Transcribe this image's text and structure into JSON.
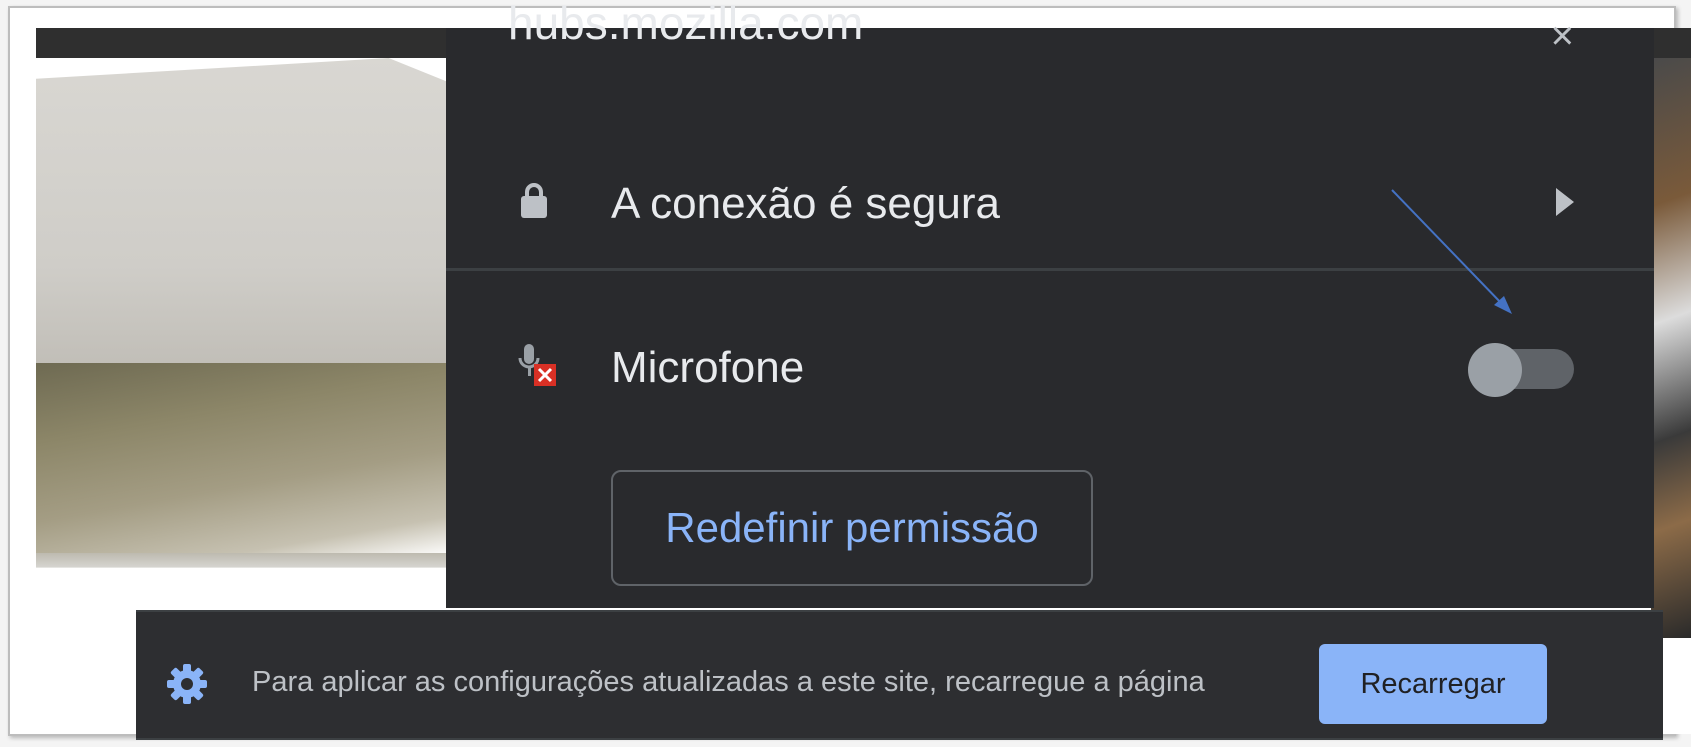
{
  "popup": {
    "domain": "hubs.mozilla.com",
    "close_glyph": "×",
    "connection": {
      "icon": "lock-icon",
      "label": "A conexão é segura",
      "chevron": "chevron-right-icon"
    },
    "microphone": {
      "icon": "microphone-blocked-icon",
      "label": "Microfone",
      "toggle_state": "off"
    },
    "reset_button_label": "Redefinir permissão"
  },
  "infobar": {
    "icon": "gear-icon",
    "message": "Para aplicar as configurações atualizadas a este site, recarregue a página",
    "reload_label": "Recarregar"
  },
  "colors": {
    "popup_bg": "#292a2d",
    "text_primary": "#e8eaed",
    "link_blue": "#8ab4f8",
    "annotation_arrow": "#4472c4",
    "blocked_red": "#d93025"
  }
}
